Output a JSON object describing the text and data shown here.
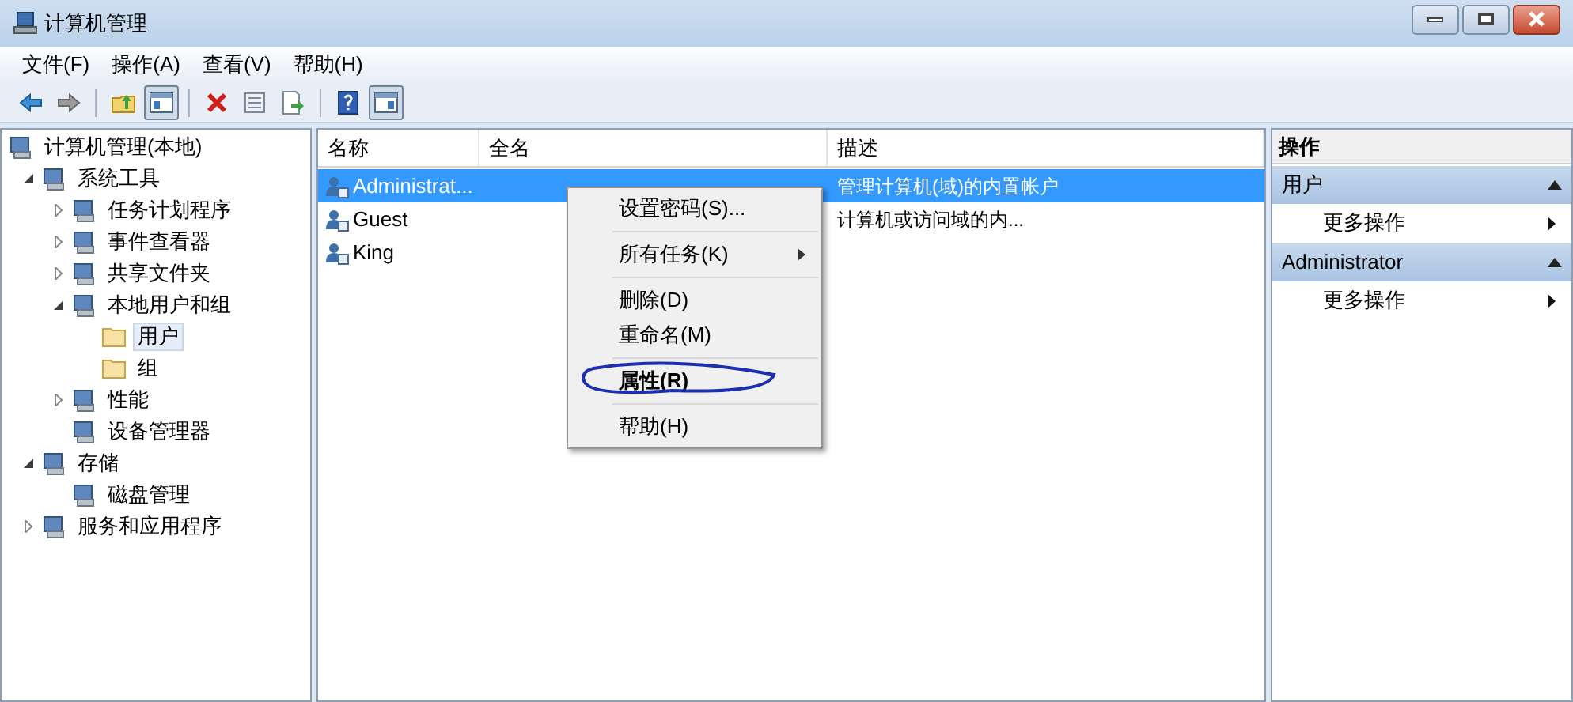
{
  "window": {
    "title": "计算机管理"
  },
  "menu_bar": [
    "文件(F)",
    "操作(A)",
    "查看(V)",
    "帮助(H)"
  ],
  "toolbar": [
    [
      {
        "pressed": false
      },
      {
        "pressed": false
      }
    ],
    [
      {
        "pressed": false
      },
      {
        "pressed": true
      }
    ],
    [
      {
        "pressed": false
      },
      {
        "pressed": false
      },
      {
        "pressed": false
      }
    ],
    [
      {
        "pressed": false
      },
      {
        "pressed": true
      }
    ]
  ],
  "tree": [
    {
      "label": "计算机管理(本地)",
      "selected": false,
      "children": [
        {
          "label": "系统工具",
          "selected": false,
          "expanded": true,
          "children": [
            {
              "label": "任务计划程序",
              "selected": false,
              "expanded": false
            },
            {
              "label": "事件查看器",
              "selected": false,
              "expanded": false
            },
            {
              "label": "共享文件夹",
              "selected": false,
              "expanded": false
            },
            {
              "label": "本地用户和组",
              "selected": false,
              "expanded": true,
              "children": [
                {
                  "label": "用户",
                  "selected": true
                },
                {
                  "label": "组",
                  "selected": false
                }
              ]
            },
            {
              "label": "性能",
              "selected": false,
              "expanded": false
            },
            {
              "label": "设备管理器",
              "selected": false
            }
          ]
        },
        {
          "label": "存储",
          "selected": false,
          "expanded": true,
          "children": [
            {
              "label": "磁盘管理",
              "selected": false
            }
          ]
        },
        {
          "label": "服务和应用程序",
          "selected": false,
          "expanded": false
        }
      ]
    }
  ],
  "list": {
    "columns": [
      "名称",
      "全名",
      "描述"
    ],
    "rows": [
      {
        "name": "Administrat...",
        "full_name": "",
        "description": "管理计算机(域)的内置帐户",
        "selected": true
      },
      {
        "name": "Guest",
        "full_name": "",
        "description": "计算机或访问域的内...",
        "selected": false
      },
      {
        "name": "King",
        "full_name": "",
        "description": "",
        "selected": false
      }
    ]
  },
  "context_menu": [
    {
      "kind": "item",
      "label": "设置密码(S)...",
      "submenu": false,
      "default": false
    },
    {
      "kind": "separator"
    },
    {
      "kind": "item",
      "label": "所有任务(K)",
      "submenu": true,
      "default": false
    },
    {
      "kind": "separator"
    },
    {
      "kind": "item",
      "label": "删除(D)",
      "submenu": false,
      "default": false
    },
    {
      "kind": "item",
      "label": "重命名(M)",
      "submenu": false,
      "default": false
    },
    {
      "kind": "separator"
    },
    {
      "kind": "item",
      "label": "属性(R)",
      "submenu": false,
      "default": true
    },
    {
      "kind": "separator"
    },
    {
      "kind": "item",
      "label": "帮助(H)",
      "submenu": false,
      "default": false
    }
  ],
  "actions": {
    "title": "操作",
    "sections": [
      {
        "title": "用户",
        "expanded": true,
        "items": [
          "更多操作"
        ]
      },
      {
        "title": "Administrator",
        "expanded": true,
        "items": [
          "更多操作"
        ]
      }
    ]
  }
}
